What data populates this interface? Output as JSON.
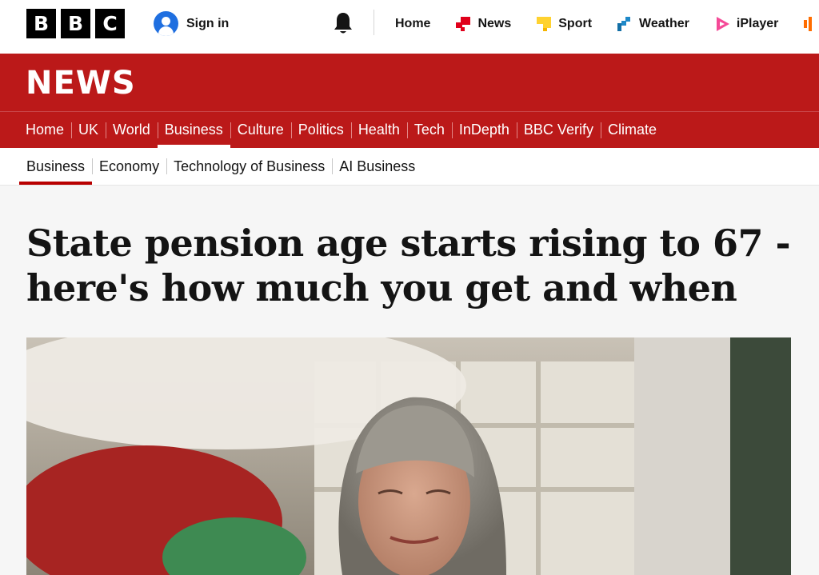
{
  "brand": {
    "letters": [
      "B",
      "B",
      "C"
    ]
  },
  "top_bar": {
    "sign_in": "Sign in",
    "nav": [
      {
        "label": "Home",
        "icon": "none"
      },
      {
        "label": "News",
        "icon": "news-icon",
        "color": "#e0001b"
      },
      {
        "label": "Sport",
        "icon": "sport-icon",
        "color": "#ffd230"
      },
      {
        "label": "Weather",
        "icon": "weather-icon",
        "color": "#1e88c8"
      },
      {
        "label": "iPlayer",
        "icon": "iplayer-icon",
        "color": "#f54997"
      }
    ]
  },
  "news_logo": "NEWS",
  "main_nav": [
    "Home",
    "UK",
    "World",
    "Business",
    "Culture",
    "Politics",
    "Health",
    "Tech",
    "InDepth",
    "BBC Verify",
    "Climate"
  ],
  "main_nav_active": "Business",
  "sub_nav": [
    "Business",
    "Economy",
    "Technology of Business",
    "AI Business"
  ],
  "sub_nav_active": "Business",
  "article": {
    "headline": "State pension age starts rising to 67 - here's how much you get and when"
  },
  "colors": {
    "brand_red": "#bb1919",
    "active_underline": "#b80000"
  }
}
